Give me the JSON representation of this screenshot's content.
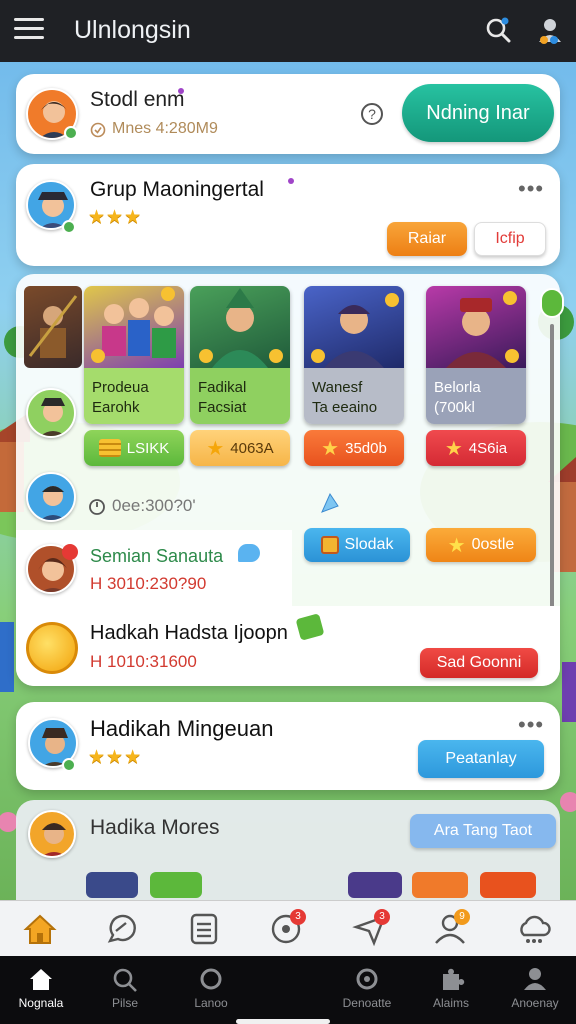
{
  "app_title": "Ulnlongsin",
  "profile_card": {
    "name": "Stodl enm",
    "subtitle": "Mnes 4:280M9",
    "action_label": "Ndning Inar"
  },
  "group_card": {
    "title": "Grup Maoningertal",
    "stars": "★★★",
    "btn_primary": "Raiar",
    "btn_secondary": "Icfip"
  },
  "tiles": [
    {
      "line1": "Prodeua",
      "line2": "Earohk",
      "price": "LSIKK"
    },
    {
      "line1": "Fadikal",
      "line2": "Facsiat",
      "price": "4063A"
    },
    {
      "line1": "Wanesf",
      "line2": "Ta eeaino",
      "price": "35d0b"
    },
    {
      "line1": "Belorla",
      "line2": "(700kl",
      "price": "4S6ia"
    }
  ],
  "timer_row": {
    "text": "0ee:300?0'"
  },
  "action_buttons": {
    "left": "Slodak",
    "right": "0ostle"
  },
  "session_row": {
    "title": "Semian Sanauta",
    "time": "H 3010:230?90"
  },
  "coin_row": {
    "title": "Hadkah Hadsta Ijoopn",
    "time": "H 1010:31600",
    "button": "Sad Goonni"
  },
  "weekly_card": {
    "title": "Hadikah Mingeuan",
    "stars": "★★★",
    "button": "Peatanlay"
  },
  "more_row": {
    "title": "Hadika Mores",
    "button": "Ara Tang Taot"
  },
  "nav_badges": {
    "chat": "3",
    "send": "3",
    "profile": "9"
  },
  "system_nav": [
    "Nognala",
    "Pilse",
    "Lanoo",
    "Denoatte",
    "Alaims",
    "Anoenay"
  ],
  "colors": {
    "topbar": "#1f2125",
    "teal_button": "#1aa98c",
    "orange": "#f39a1c",
    "red": "#e23b38",
    "blue": "#2b9ad8",
    "green": "#5cb83b"
  }
}
